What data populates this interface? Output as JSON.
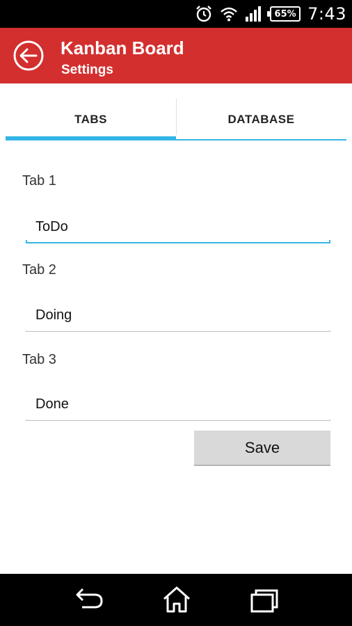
{
  "status_bar": {
    "time": "7:43",
    "battery": "65%",
    "icons": [
      "alarm-icon",
      "wifi-icon",
      "signal-icon",
      "battery-icon"
    ]
  },
  "app_bar": {
    "title": "Kanban Board",
    "subtitle": "Settings",
    "color": "#d32f2f",
    "back_icon": "back-arrow-icon"
  },
  "tabs": [
    {
      "label": "TABS",
      "selected": true
    },
    {
      "label": "DATABASE",
      "selected": false
    }
  ],
  "accent_color": "#33b5e5",
  "form": {
    "fields": [
      {
        "label": "Tab 1",
        "value": "ToDo"
      },
      {
        "label": "Tab 2",
        "value": "Doing"
      },
      {
        "label": "Tab 3",
        "value": "Done"
      }
    ],
    "save_label": "Save"
  },
  "nav_bar": {
    "buttons": [
      "back-icon",
      "home-icon",
      "recent-apps-icon"
    ]
  }
}
